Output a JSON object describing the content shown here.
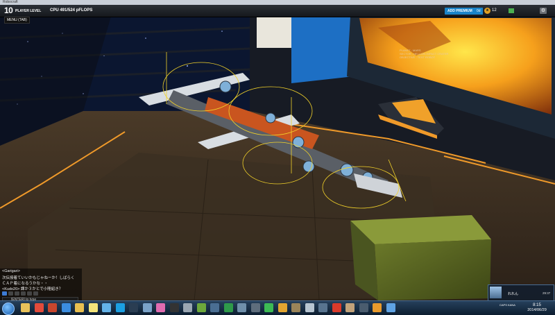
{
  "window": {
    "title": "Robocraft"
  },
  "hud": {
    "level": "10",
    "level_label": "PLAYER LEVEL",
    "cpu_label": "CPU 491/524 pFLOPS",
    "menu_label": "MENU (TAB)",
    "premium_label": "ADD PREMIUM",
    "premium_days": "0d",
    "rp_value": "12",
    "coins_value": "",
    "screen_lines": [
      "PLANET - MARS",
      "SECTOR - HELLION IMPACT CRATER",
      "OBJECTIVE - TEST ROBOT"
    ]
  },
  "chat": {
    "lines": [
      "<Garigari>",
      "次伝授着ていいかもじゃねーか！しばらく",
      "ＣＡＰ着になるうかな・・",
      "<Kudo20> 課か３かとで小隆紹き？"
    ],
    "tabs": [
      "",
      "",
      "",
      "",
      "",
      ""
    ],
    "input_hint": "[ENTER] to type"
  },
  "notification": {
    "name": "れれん",
    "time": "29:37"
  },
  "taskbar": {
    "icons": [
      {
        "name": "explorer-icon",
        "color": "#e7c15a"
      },
      {
        "name": "chrome-icon",
        "color": "#e24b3b"
      },
      {
        "name": "mail-icon",
        "color": "#c8462d"
      },
      {
        "name": "media-player-icon",
        "color": "#3b8de0"
      },
      {
        "name": "folder-icon",
        "color": "#e9bf4f"
      },
      {
        "name": "notes-icon",
        "color": "#f3e47a"
      },
      {
        "name": "network-icon",
        "color": "#63b2e8"
      },
      {
        "name": "skype-icon",
        "color": "#1b9fe2"
      },
      {
        "name": "steam-icon",
        "color": "#2a3d52"
      },
      {
        "name": "utility-icon",
        "color": "#7aa2c8"
      },
      {
        "name": "lips-icon",
        "color": "#e06bb0"
      },
      {
        "name": "terminal-icon",
        "color": "#333333"
      },
      {
        "name": "calculator-icon",
        "color": "#9aa6b2"
      },
      {
        "name": "minecraft-icon",
        "color": "#6da83b"
      },
      {
        "name": "gear-icon",
        "color": "#4a6e92"
      },
      {
        "name": "monitor-icon",
        "color": "#2e9a4a"
      },
      {
        "name": "tools-icon",
        "color": "#6f8faa"
      },
      {
        "name": "circle-tool-icon",
        "color": "#5e6d7c"
      },
      {
        "name": "green-app-icon",
        "color": "#3cba54"
      },
      {
        "name": "video-icon",
        "color": "#e2a530"
      },
      {
        "name": "photo-icon",
        "color": "#9a8459"
      },
      {
        "name": "smartphone-icon",
        "color": "#b7c5d1"
      },
      {
        "name": "camera-icon",
        "color": "#58748f"
      },
      {
        "name": "record-icon",
        "color": "#d93a2a"
      },
      {
        "name": "dictionary-icon",
        "color": "#c2a27a"
      },
      {
        "name": "game-icon",
        "color": "#4a5c6e"
      },
      {
        "name": "robocraft-icon",
        "color": "#e89a2c"
      },
      {
        "name": "chat-icon",
        "color": "#5fa3e4"
      }
    ],
    "tray_lang": "CAPS KANA",
    "time": "8:15",
    "date": "2014/06/29"
  }
}
